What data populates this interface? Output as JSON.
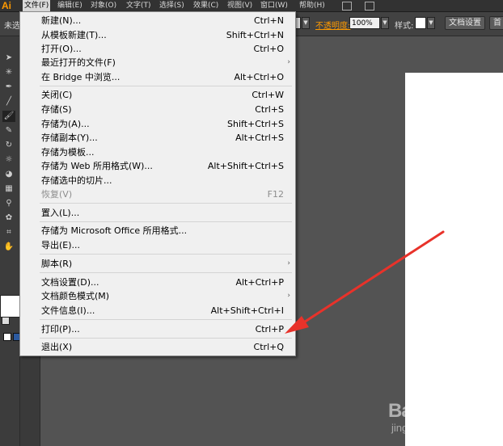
{
  "app": {
    "logo": "Ai"
  },
  "menubar": {
    "items": [
      {
        "label": "文件(F)"
      },
      {
        "label": "编辑(E)"
      },
      {
        "label": "对象(O)"
      },
      {
        "label": "文字(T)"
      },
      {
        "label": "选择(S)"
      },
      {
        "label": "效果(C)"
      },
      {
        "label": "视图(V)"
      },
      {
        "label": "窗口(W)"
      },
      {
        "label": "帮助(H)"
      }
    ]
  },
  "controlbar": {
    "selection_label": "未选",
    "opacity_label": "不透明度:",
    "opacity_value": "100%",
    "style_label": "样式:",
    "doc_settings_label": "文档设置",
    "prefs_label": "首"
  },
  "file_menu": {
    "items": [
      {
        "label": "新建(N)...",
        "shortcut": "Ctrl+N"
      },
      {
        "label": "从模板新建(T)...",
        "shortcut": "Shift+Ctrl+N"
      },
      {
        "label": "打开(O)...",
        "shortcut": "Ctrl+O"
      },
      {
        "label": "最近打开的文件(F)",
        "shortcut": ""
      },
      {
        "label": "在 Bridge 中浏览...",
        "shortcut": "Alt+Ctrl+O"
      },
      {
        "label": "关闭(C)",
        "shortcut": "Ctrl+W"
      },
      {
        "label": "存储(S)",
        "shortcut": "Ctrl+S"
      },
      {
        "label": "存储为(A)...",
        "shortcut": "Shift+Ctrl+S"
      },
      {
        "label": "存储副本(Y)...",
        "shortcut": "Alt+Ctrl+S"
      },
      {
        "label": "存储为模板...",
        "shortcut": ""
      },
      {
        "label": "存储为 Web 所用格式(W)...",
        "shortcut": "Alt+Shift+Ctrl+S"
      },
      {
        "label": "存储选中的切片...",
        "shortcut": ""
      },
      {
        "label": "恢复(V)",
        "shortcut": "F12"
      },
      {
        "label": "置入(L)...",
        "shortcut": ""
      },
      {
        "label": "存储为 Microsoft Office 所用格式...",
        "shortcut": ""
      },
      {
        "label": "导出(E)...",
        "shortcut": ""
      },
      {
        "label": "脚本(R)",
        "shortcut": ""
      },
      {
        "label": "文档设置(D)...",
        "shortcut": "Alt+Ctrl+P"
      },
      {
        "label": "文档颜色模式(M)",
        "shortcut": ""
      },
      {
        "label": "文件信息(I)...",
        "shortcut": "Alt+Shift+Ctrl+I"
      },
      {
        "label": "打印(P)...",
        "shortcut": "Ctrl+P"
      },
      {
        "label": "退出(X)",
        "shortcut": "Ctrl+Q"
      }
    ]
  },
  "watermark": {
    "main": "Baidu经验",
    "sub": "jingyan.baidu.com"
  },
  "colors": {
    "accent_orange": "#ff9a00",
    "annotation_arrow": "#e8322a",
    "menu_bg": "#f0f0f0",
    "canvas_bg": "#535353"
  }
}
